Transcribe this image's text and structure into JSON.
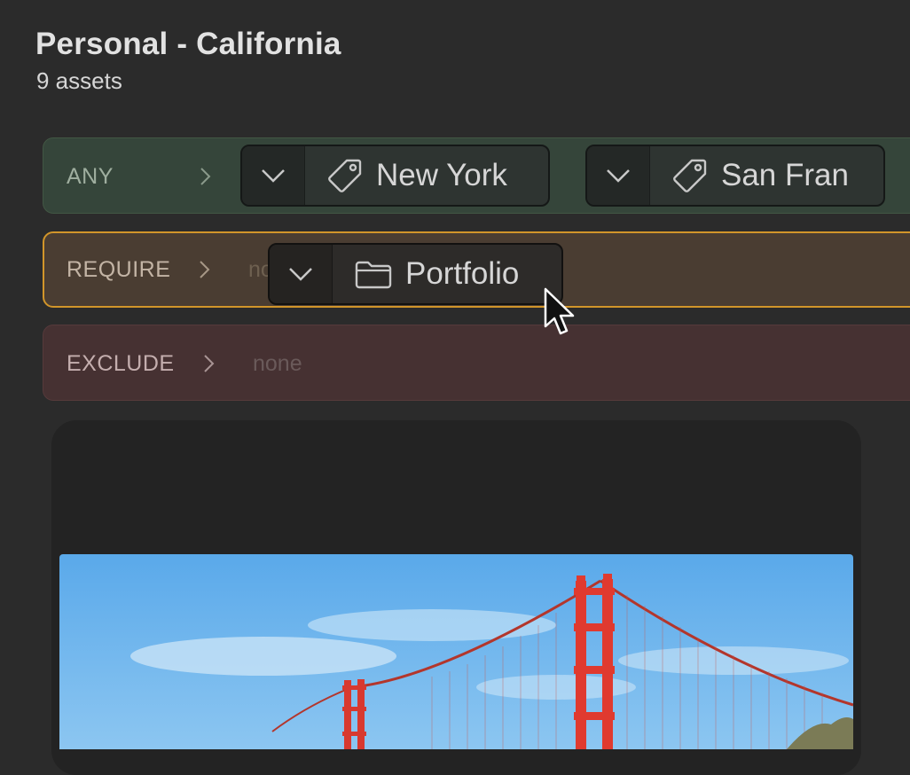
{
  "header": {
    "title": "Personal - California",
    "subtitle": "9 assets"
  },
  "rules": {
    "any": {
      "label": "ANY",
      "chips": [
        {
          "label": "New York",
          "icon": "tag-icon"
        },
        {
          "label": "San Fran",
          "icon": "tag-icon"
        }
      ]
    },
    "require": {
      "label": "REQUIRE",
      "placeholder": "none",
      "dragging_chip": {
        "label": "Portfolio",
        "icon": "folder-icon"
      }
    },
    "exclude": {
      "label": "EXCLUDE",
      "placeholder": "none"
    }
  },
  "photo": {
    "subject": "Golden Gate Bridge"
  },
  "colors": {
    "background": "#2b2b2b",
    "any_row": "#35453a",
    "require_row": "#4a3d32",
    "require_border": "#d1952a",
    "exclude_row": "#463132",
    "bridge_red": "#e03a2f"
  }
}
